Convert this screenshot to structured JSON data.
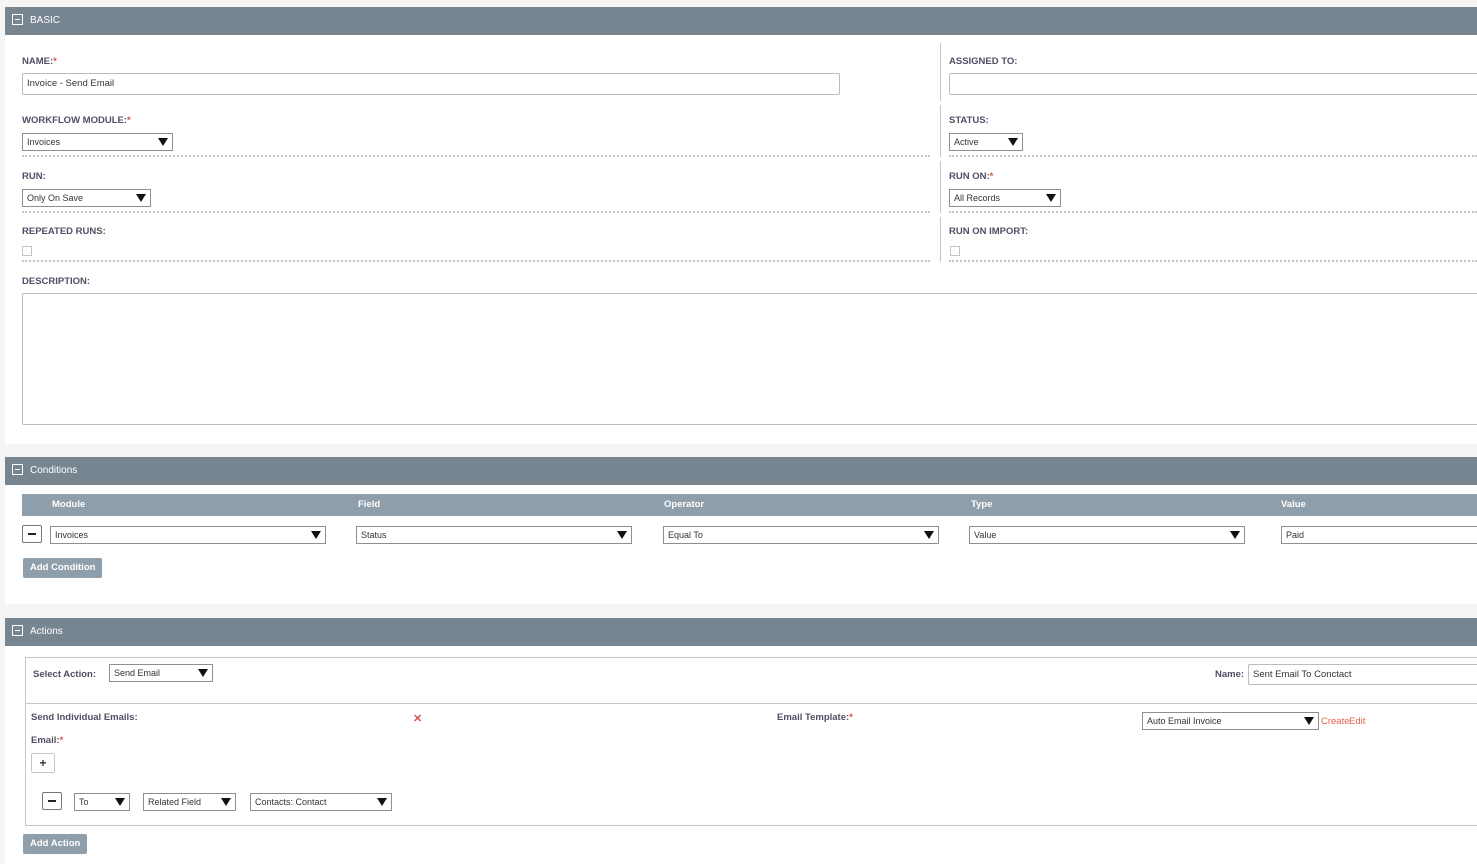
{
  "basic": {
    "header": "BASIC",
    "name_label": "NAME:",
    "name_value": "Invoice - Send Email",
    "assigned_label": "ASSIGNED TO:",
    "assigned_value": "",
    "module_label": "WORKFLOW MODULE:",
    "module_value": "Invoices",
    "status_label": "STATUS:",
    "status_value": "Active",
    "run_label": "RUN:",
    "run_value": "Only On Save",
    "run_on_label": "RUN ON:",
    "run_on_value": "All Records",
    "repeated_label": "REPEATED RUNS:",
    "run_import_label": "RUN ON IMPORT:",
    "description_label": "DESCRIPTION:",
    "description_value": "",
    "required_mark": "*"
  },
  "conditions": {
    "header": "Conditions",
    "columns": [
      "Module",
      "Field",
      "Operator",
      "Type",
      "Value"
    ],
    "row": {
      "module": "Invoices",
      "field": "Status",
      "operator": "Equal To",
      "type": "Value",
      "value": "Paid"
    },
    "add_label": "Add Condition"
  },
  "actions": {
    "header": "Actions",
    "select_action_label": "Select Action:",
    "select_action_value": "Send Email",
    "name_label": "Name:",
    "name_value": "Sent Email To Conctact",
    "send_individual_label": "Send Individual Emails:",
    "remove_mark": "✕",
    "email_template_label": "Email Template:",
    "email_template_value": "Auto Email Invoice",
    "create_link": "Create",
    "edit_link": "Edit",
    "email_label": "Email:",
    "plus": "+",
    "recipient": {
      "to": "To",
      "kind": "Related Field",
      "field": "Contacts: Contact"
    },
    "add_label": "Add Action"
  },
  "colors": {
    "header_bg": "#778591",
    "table_header_bg": "#8f9eab",
    "required": "#d9534f",
    "link": "#e5624b"
  }
}
